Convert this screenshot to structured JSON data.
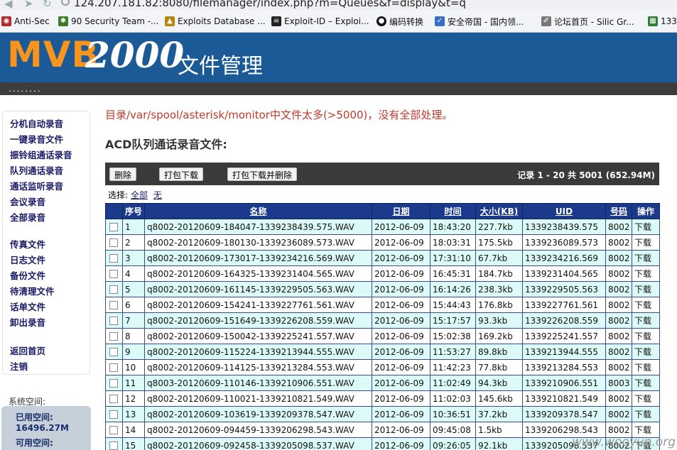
{
  "browser": {
    "url": "124.207.181.82:8080/filemanager/index.php?m=Queues&f=display&t=q",
    "bookmarks": [
      {
        "label": "Anti-Sec",
        "icon": "anti-sec-icon",
        "color": "#b8282a"
      },
      {
        "label": "90 Security Team -...",
        "icon": "bug-icon",
        "color": "#3d7a2a"
      },
      {
        "label": "Exploits Database ...",
        "icon": "exploit-db-icon",
        "color": "#b8860b"
      },
      {
        "label": "Exploit-ID – Exploi...",
        "icon": "skull-icon",
        "color": "#222222"
      },
      {
        "label": "编码转换",
        "icon": "github-icon",
        "color": "#111111"
      },
      {
        "label": "安全帝国 - 国内领...",
        "icon": "shield-icon",
        "color": "#3b6fc4"
      },
      {
        "label": "论坛首页 - Silic Gr...",
        "icon": "forum-icon",
        "color": "#777777"
      },
      {
        "label": "133",
        "icon": "folder-icon",
        "color": "#2f7d32"
      }
    ]
  },
  "banner": {
    "logo_mvb": "MVB",
    "logo_num": "2000",
    "logo_sub": "文件管理",
    "dots": "........"
  },
  "sidebar": {
    "items": [
      "分机自动录音",
      "一键录音文件",
      "振铃组通话录音",
      "队列通话录音",
      "通话监听录音",
      "会议录音",
      "全部录音"
    ],
    "items2": [
      "传真文件",
      "日志文件",
      "备份文件",
      "待清理文件",
      "话单文件",
      "卸出录音"
    ],
    "items3": [
      "返回首页",
      "注销"
    ],
    "sys_label": "系统空间:",
    "used_label": "已用空间:",
    "used_value": "16496.27M",
    "free_label": "可用空间:"
  },
  "main": {
    "warning": "目录/var/spool/asterisk/monitor中文件太多(>5000)，没有全部处理。",
    "title": "ACD队列通话录音文件:",
    "buttons": {
      "delete": "删除",
      "pack": "打包下载",
      "pack_delete": "打包下载并删除"
    },
    "records": "记录 1 - 20 共 5001 (652.94M)",
    "select_label": "选择:",
    "select_all": "全部",
    "select_none": "无",
    "columns": [
      "序号",
      "名称",
      "日期",
      "时间",
      "大小(KB)",
      "UID",
      "号码",
      "操作"
    ],
    "rows": [
      {
        "no": "1",
        "name": "q8002-20120609-184047-1339238439.575.WAV",
        "date": "2012-06-09",
        "time": "18:43:20",
        "size": "227.7kb",
        "uid": "1339238439.575",
        "num": "8002",
        "op": "下载"
      },
      {
        "no": "2",
        "name": "q8002-20120609-180130-1339236089.573.WAV",
        "date": "2012-06-09",
        "time": "18:03:31",
        "size": "175.5kb",
        "uid": "1339236089.573",
        "num": "8002",
        "op": "下载"
      },
      {
        "no": "3",
        "name": "q8002-20120609-173017-1339234216.569.WAV",
        "date": "2012-06-09",
        "time": "17:31:10",
        "size": "67.7kb",
        "uid": "1339234216.569",
        "num": "8002",
        "op": "下载"
      },
      {
        "no": "4",
        "name": "q8002-20120609-164325-1339231404.565.WAV",
        "date": "2012-06-09",
        "time": "16:45:31",
        "size": "184.7kb",
        "uid": "1339231404.565",
        "num": "8002",
        "op": "下载"
      },
      {
        "no": "5",
        "name": "q8002-20120609-161145-1339229505.563.WAV",
        "date": "2012-06-09",
        "time": "16:14:26",
        "size": "238.3kb",
        "uid": "1339229505.563",
        "num": "8002",
        "op": "下载"
      },
      {
        "no": "6",
        "name": "q8002-20120609-154241-1339227761.561.WAV",
        "date": "2012-06-09",
        "time": "15:44:43",
        "size": "176.8kb",
        "uid": "1339227761.561",
        "num": "8002",
        "op": "下载"
      },
      {
        "no": "7",
        "name": "q8002-20120609-151649-1339226208.559.WAV",
        "date": "2012-06-09",
        "time": "15:17:57",
        "size": "93.3kb",
        "uid": "1339226208.559",
        "num": "8002",
        "op": "下载"
      },
      {
        "no": "8",
        "name": "q8002-20120609-150042-1339225241.557.WAV",
        "date": "2012-06-09",
        "time": "15:02:38",
        "size": "169.2kb",
        "uid": "1339225241.557",
        "num": "8002",
        "op": "下载"
      },
      {
        "no": "9",
        "name": "q8002-20120609-115224-1339213944.555.WAV",
        "date": "2012-06-09",
        "time": "11:53:27",
        "size": "89.8kb",
        "uid": "1339213944.555",
        "num": "8002",
        "op": "下载"
      },
      {
        "no": "10",
        "name": "q8002-20120609-114125-1339213284.553.WAV",
        "date": "2012-06-09",
        "time": "11:42:23",
        "size": "77.8kb",
        "uid": "1339213284.553",
        "num": "8002",
        "op": "下载"
      },
      {
        "no": "11",
        "name": "q8003-20120609-110146-1339210906.551.WAV",
        "date": "2012-06-09",
        "time": "11:02:49",
        "size": "94.3kb",
        "uid": "1339210906.551",
        "num": "8003",
        "op": "下载"
      },
      {
        "no": "12",
        "name": "q8002-20120609-110021-1339210821.549.WAV",
        "date": "2012-06-09",
        "time": "11:02:03",
        "size": "145.6kb",
        "uid": "1339210821.549",
        "num": "8002",
        "op": "下载"
      },
      {
        "no": "13",
        "name": "q8002-20120609-103619-1339209378.547.WAV",
        "date": "2012-06-09",
        "time": "10:36:51",
        "size": "37.2kb",
        "uid": "1339209378.547",
        "num": "8002",
        "op": "下载"
      },
      {
        "no": "14",
        "name": "q8002-20120609-094459-1339206298.543.WAV",
        "date": "2012-06-09",
        "time": "09:45:08",
        "size": "1.5kb",
        "uid": "1339206298.543",
        "num": "8002",
        "op": "下载"
      },
      {
        "no": "15",
        "name": "q8002-20120609-092458-1339205098.537.WAV",
        "date": "2012-06-09",
        "time": "09:26:05",
        "size": "92.1kb",
        "uid": "1339205098.537",
        "num": "8002",
        "op": "下载"
      }
    ]
  },
  "watermark": "www.wooyun.org",
  "colors": {
    "banner": "#1b5a97",
    "logo_orange": "#f7941d",
    "header": "#1c3a8c",
    "row_alt": "#dcfaf7",
    "warning": "#c0392b"
  }
}
